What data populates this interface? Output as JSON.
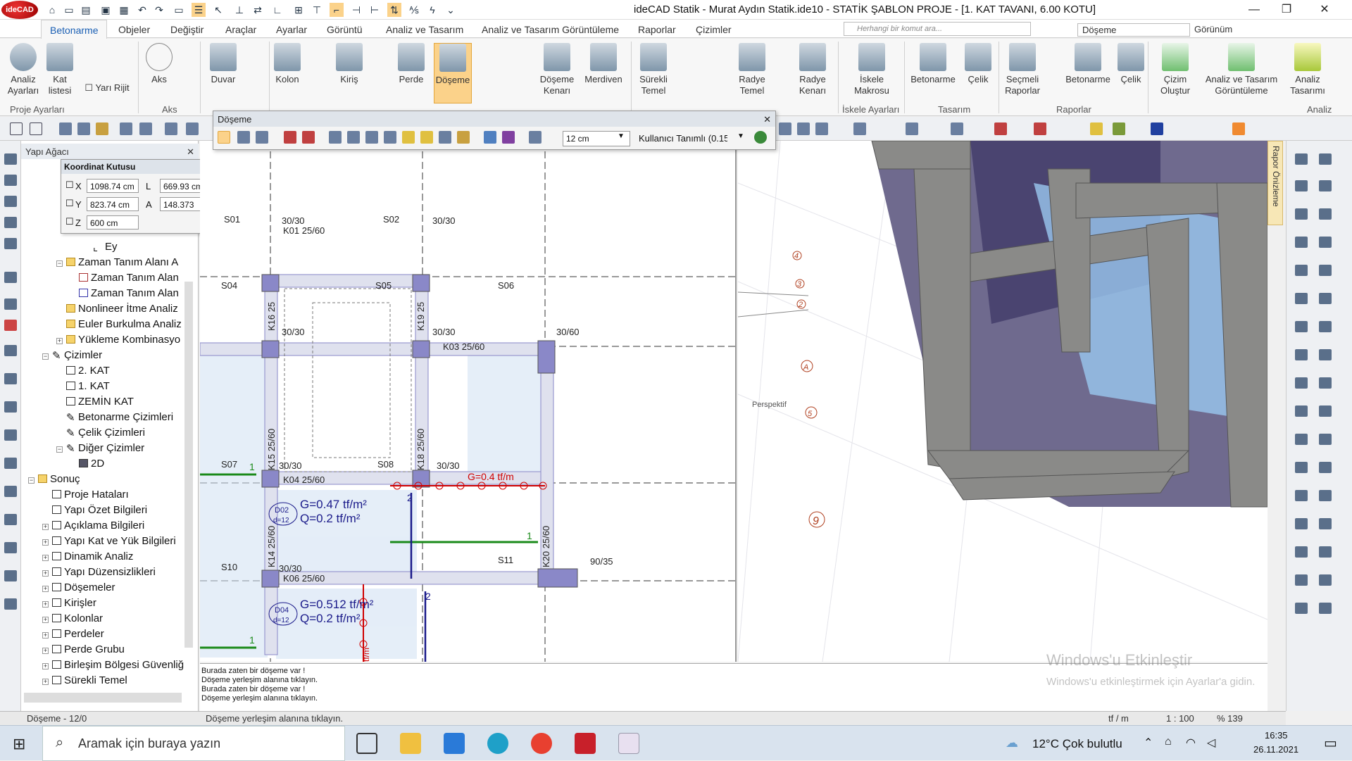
{
  "app": {
    "title": "ideCAD Statik - Murat Aydın Statik.ide10 - STATİK ŞABLON PROJE - [1. KAT TAVANI,  6.00 KOTU]",
    "logo": "ideCAD"
  },
  "menu": {
    "tabs": [
      "Betonarme",
      "Objeler",
      "Değiştir",
      "Araçlar",
      "Ayarlar",
      "Görüntü",
      "Analiz ve Tasarım",
      "Analiz ve Tasarım Görüntüleme",
      "Raporlar",
      "Çizimler"
    ],
    "active": "Betonarme",
    "search_placeholder": "Herhangi bir komut ara...",
    "doseme_combo": "Döşeme",
    "gorunum": "Görünüm"
  },
  "ribbon": {
    "buttons": [
      "Analiz Ayarları",
      "Kat listesi",
      "Yarı Rijit",
      "Aks",
      "Duvar",
      "Kolon",
      "Kiriş",
      "Perde",
      "Döşeme",
      "Döşeme Kenarı",
      "Merdiven",
      "Sürekli Temel",
      "Radye Temel",
      "Radye Kenarı",
      "İskele Makrosu",
      "Betonarme",
      "Çelik",
      "Seçmeli Raporlar",
      "Betonarme",
      "Çelik",
      "Çizim Oluştur",
      "Analiz ve Tasarım Görüntüleme",
      "Analiz Tasarımı"
    ],
    "groups": [
      "Proje Ayarları",
      "Aks",
      "İskele Ayarları",
      "Tasarım",
      "Raporlar",
      "Analiz"
    ]
  },
  "tree": {
    "title": "Yapı Ağacı",
    "items": [
      "Ey",
      "Zaman Tanım Alanı A",
      "Zaman Tanım Alan",
      "Zaman Tanım Alan",
      "Nonlineer İtme Analiz",
      "Euler Burkulma Analiz",
      "Yükleme Kombinasyo",
      "Çizimler",
      "2. KAT",
      "1. KAT",
      "ZEMİN KAT",
      "Betonarme Çizimleri",
      "Çelik Çizimleri",
      "Diğer Çizimler",
      "2D",
      "Sonuç",
      "Proje Hataları",
      "Yapı Özet Bilgileri",
      "Açıklama Bilgileri",
      "Yapı Kat ve Yük Bilgileri",
      "Dinamik Analiz",
      "Yapı Düzensizlikleri",
      "Döşemeler",
      "Kirişler",
      "Kolonlar",
      "Perdeler",
      "Perde Grubu",
      "Birleşim Bölgesi Güvenliğ",
      "Sürekli Temel"
    ]
  },
  "coord": {
    "title": "Koordinat Kutusu",
    "x_label": "X",
    "x": "1098.74 cm",
    "l_label": "L",
    "l": "669.93 cm",
    "y_label": "Y",
    "y": "823.74 cm",
    "a_label": "A",
    "a": "148.373",
    "z_label": "Z",
    "z": "600 cm"
  },
  "doseme": {
    "title": "Döşeme",
    "thickness": "12 cm",
    "material": "Kullanıcı Tanımlı (0.15"
  },
  "plan": {
    "labels": {
      "s01": "S01",
      "s02": "S02",
      "s04": "S04",
      "s05": "S05",
      "s06": "S06",
      "s07": "S07",
      "s08": "S08",
      "s10": "S10",
      "s11": "S11",
      "k01": "K01 25/60",
      "k03": "K03 25/60",
      "k04": "K04 25/60",
      "k06": "K06 25/60",
      "k14": "K14 25/60",
      "k15": "K15 25/60",
      "k16": "K16 25",
      "k18": "K18 25/60",
      "k19": "K19 25",
      "k20": "K20 25/60",
      "c3030a": "30/30",
      "c3030b": "30/30",
      "c3030c": "30/30",
      "c3030d": "30/30",
      "c3060": "30/60",
      "c3030e": "30/30",
      "c3030f": "30/30",
      "c3030g": "30/30",
      "c9035": "90/35",
      "g04": "G=0.4 tf/m",
      "d02": "D02",
      "d02h": "d=12",
      "d04": "D04",
      "d04h": "d=12",
      "g047": "G=0.47 tf/m²",
      "q02a": "Q=0.2 tf/m²",
      "g0512": "G=0.512 tf/m²",
      "q02b": "Q=0.2 tf/m²",
      "n1a": "1",
      "n1b": "1",
      "n1c": "1",
      "n2a": "2",
      "n2b": "2",
      "tfm": "tf/m"
    }
  },
  "view3d": {
    "label": "Perspektif",
    "side_tab": "Rapor Önizleme",
    "axis": [
      "4",
      "3",
      "2",
      "A",
      "5",
      "9"
    ]
  },
  "messages": [
    "Burada zaten bir döşeme var !",
    "Döşeme yerleşim alanına tıklayın.",
    "Burada zaten bir döşeme var !",
    "Döşeme yerleşim alanına tıklayın."
  ],
  "status": {
    "left": "Döşeme - 12/0",
    "prompt": "Döşeme yerleşim alanına tıklayın.",
    "unit": "tf / m",
    "scale": "1 : 100",
    "zoom": "% 139"
  },
  "watermark": {
    "line1": "Windows'u Etkinleştir",
    "line2": "Windows'u etkinleştirmek için Ayarlar'a gidin."
  },
  "taskbar": {
    "search": "Aramak için buraya yazın",
    "weather": "12°C  Çok bulutlu",
    "time": "16:35",
    "date": "26.11.2021"
  },
  "colors": {
    "accent": "#1a5fb4",
    "selected": "#fbd28a",
    "beam": "#8a88c8",
    "red": "#d00000",
    "green": "#1a8a1a"
  }
}
